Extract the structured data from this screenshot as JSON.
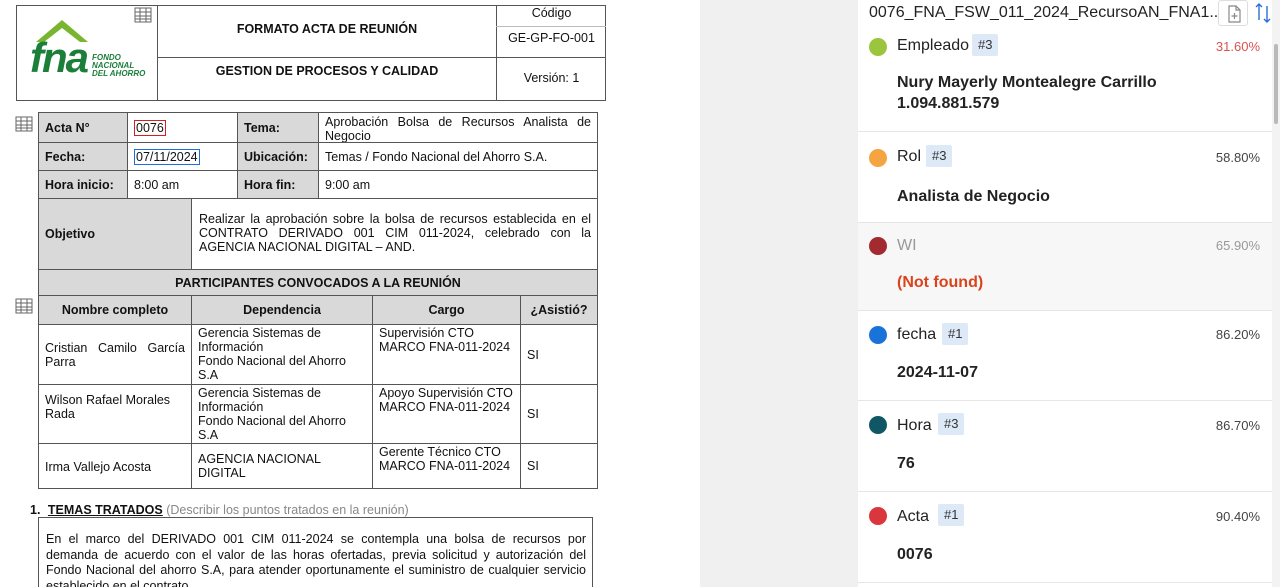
{
  "document": {
    "logo": {
      "letters": "fna",
      "line1": "FONDO",
      "line2": "NACIONAL",
      "line3": "DEL AHORRO"
    },
    "header": {
      "title": "FORMATO ACTA DE REUNIÓN",
      "subtitle": "GESTION DE PROCESOS Y CALIDAD",
      "codigo_label": "Código",
      "codigo_value": "GE-GP-FO-001",
      "version": "Versión: 1"
    },
    "meta": {
      "acta_label": "Acta N°",
      "acta_value": "0076",
      "tema_label": "Tema:",
      "tema_value": "Aprobación Bolsa de Recursos Analista de Negocio",
      "fecha_label": "Fecha:",
      "fecha_value": "07/11/2024",
      "ubicacion_label": "Ubicación:",
      "ubicacion_value": "Temas / Fondo Nacional del Ahorro S.A.",
      "hora_inicio_label": "Hora inicio:",
      "hora_inicio_value": "8:00 am",
      "hora_fin_label": "Hora fin:",
      "hora_fin_value": "9:00 am",
      "objetivo_label": "Objetivo",
      "objetivo_value": "Realizar la aprobación sobre la bolsa de recursos establecida en el CONTRATO DERIVADO 001 CIM 011-2024, celebrado con la AGENCIA NACIONAL DIGITAL – AND."
    },
    "participants": {
      "title": "PARTICIPANTES CONVOCADOS A LA REUNIÓN",
      "columns": [
        "Nombre completo",
        "Dependencia",
        "Cargo",
        "¿Asistió?"
      ],
      "rows": [
        {
          "nombre": "Cristian Camilo García Parra",
          "dependencia": "Gerencia Sistemas de Información\nFondo Nacional del Ahorro S.A",
          "cargo": "Supervisión CTO MARCO FNA-011-2024",
          "asistio": "SI"
        },
        {
          "nombre": "Wilson Rafael Morales Rada",
          "dependencia": "Gerencia Sistemas de Información\nFondo Nacional del Ahorro S.A",
          "cargo": "Apoyo Supervisión CTO MARCO FNA-011-2024",
          "asistio": "SI"
        },
        {
          "nombre": "Irma Vallejo Acosta",
          "dependencia": "AGENCIA NACIONAL DIGITAL",
          "cargo": "Gerente Técnico CTO MARCO FNA-011-2024",
          "asistio": "SI"
        }
      ]
    },
    "temas": {
      "number": "1.",
      "title": "TEMAS TRATADOS",
      "hint": "(Describir los puntos tratados en la reunión)",
      "body": "En el marco del DERIVADO 001 CIM 011-2024 se contempla una bolsa de recursos por demanda de acuerdo con el valor de las horas ofertadas, previa solicitud y autorización del Fondo Nacional del ahorro S.A, para atender oportunamente el suministro de cualquier servicio establecido en el contrato."
    }
  },
  "panel": {
    "filename": "0076_FNA_FSW_011_2024_RecursoAN_FNA1...",
    "entities": [
      {
        "name": "Empleado",
        "badge": "#3",
        "pct": "31.60%",
        "pct_color": "#d9534f",
        "dot_color": "#9bc53d",
        "value": "Nury Mayerly Montealegre Carrillo\n1.094.881.579",
        "value_color": "#222",
        "name_color": "#222"
      },
      {
        "name": "Rol",
        "badge": "#3",
        "pct": "58.80%",
        "pct_color": "#444",
        "dot_color": "#f5a442",
        "value": "Analista de Negocio",
        "value_color": "#222",
        "name_color": "#222"
      },
      {
        "name": "WI",
        "badge": "",
        "pct": "65.90%",
        "pct_color": "#999",
        "dot_color": "#a32a2f",
        "value": "(Not found)",
        "value_color": "#d9441c",
        "name_color": "#999"
      },
      {
        "name": "fecha",
        "badge": "#1",
        "pct": "86.20%",
        "pct_color": "#444",
        "dot_color": "#1a73d9",
        "value": "2024-11-07",
        "value_color": "#222",
        "name_color": "#222"
      },
      {
        "name": "Hora",
        "badge": "#3",
        "pct": "86.70%",
        "pct_color": "#444",
        "dot_color": "#0f5765",
        "value": "76",
        "value_color": "#222",
        "name_color": "#222"
      },
      {
        "name": "Acta",
        "badge": "#1",
        "pct": "90.40%",
        "pct_color": "#444",
        "dot_color": "#d9363e",
        "value": "0076",
        "value_color": "#222",
        "name_color": "#222"
      }
    ]
  }
}
